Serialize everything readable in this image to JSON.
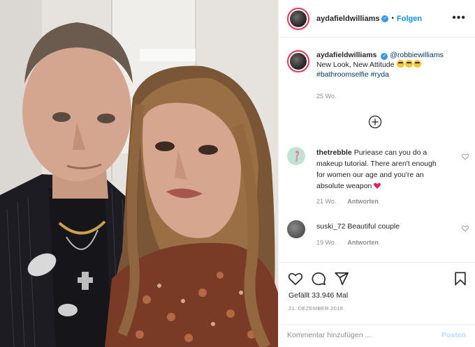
{
  "post": {
    "username": "aydafieldwilliams",
    "follow_label": "Folgen",
    "separator": "•",
    "more_label": "•••"
  },
  "caption": {
    "username": "aydafieldwilliams",
    "mention": "@robbiewilliams",
    "text": "New Look, New Attitude",
    "hashtags": "#bathroomselfie #ryda",
    "time": "25 Wo."
  },
  "comments": [
    {
      "username": "thetrebble",
      "text": "Puriease can you do a makeup tutorial. There aren't enough for women our age and you're an absolute weapon",
      "time": "21 Wo.",
      "reply_label": "Antworten"
    },
    {
      "username": "suski_72",
      "text": "Beautiful couple",
      "time": "19 Wo.",
      "reply_label": "Antworten"
    }
  ],
  "engagement": {
    "likes": "Gefällt 33.946 Mal",
    "date": "21. DEZEMBER 2019"
  },
  "comment_box": {
    "placeholder": "Kommentar hinzufügen ...",
    "post_label": "Posten"
  },
  "colors": {
    "accent": "#0095f6",
    "story_ring": "#e8325b",
    "verified": "#3897f0",
    "heart_emoji": "#e0245e"
  }
}
